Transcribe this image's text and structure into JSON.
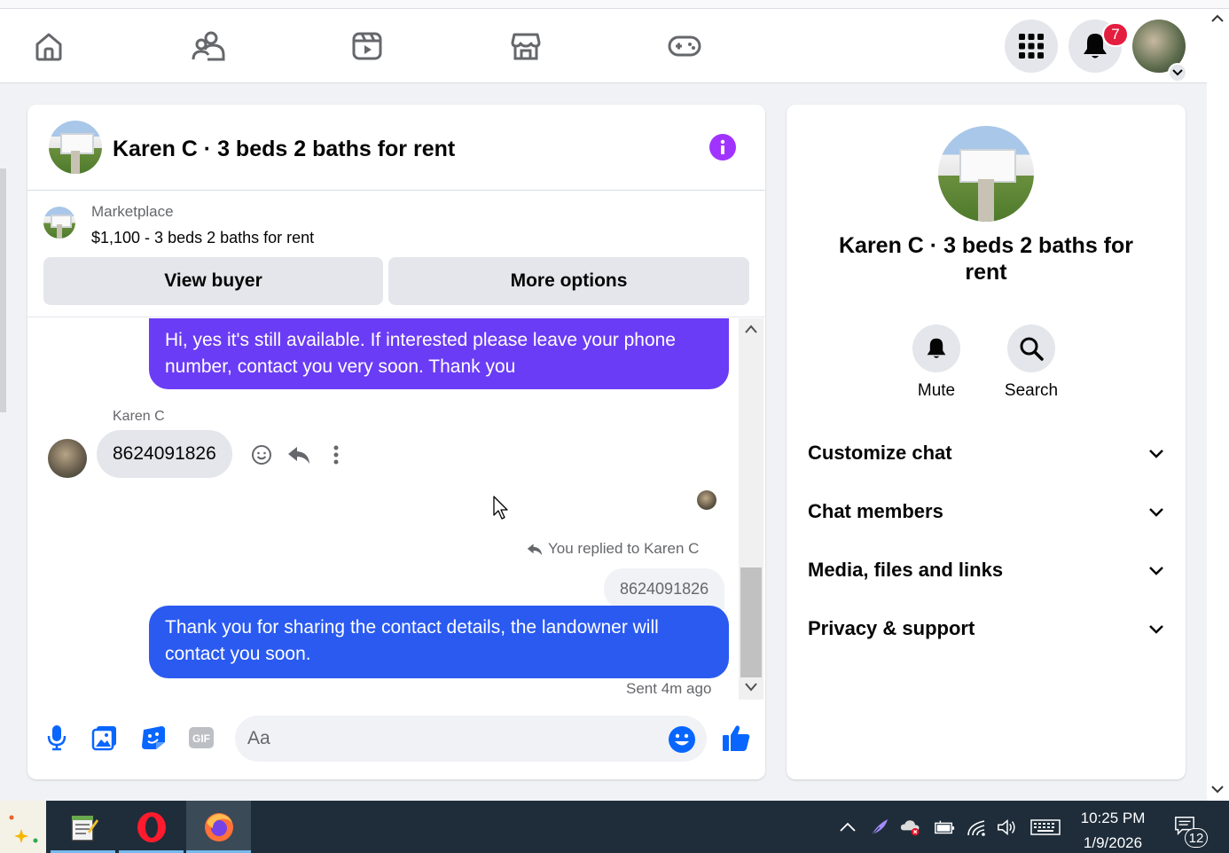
{
  "nav": {
    "icons": [
      "home-icon",
      "friends-icon",
      "video-icon",
      "marketplace-icon",
      "gaming-icon"
    ],
    "menu_icon": "grid-menu-icon",
    "notifications_badge": "7"
  },
  "chat": {
    "title": "Karen C · 3 beds 2 baths for rent",
    "marketplace_label": "Marketplace",
    "listing": "$1,100 - 3 beds 2 baths for rent",
    "view_buyer_label": "View buyer",
    "more_options_label": "More options",
    "messages": {
      "outgoing_1": "Hi, yes it's still available. If interested please leave your phone number, contact you very soon. Thank you",
      "sender_name": "Karen C",
      "incoming_1": "8624091826",
      "replied_label": "You replied to Karen C",
      "quoted_text": "8624091826",
      "outgoing_2": "Thank you for sharing the contact details, the landowner will contact you soon.",
      "sent_status": "Sent 4m ago"
    },
    "composer": {
      "placeholder": "Aa"
    },
    "colors": {
      "bubble_purple": "#6b3cf5",
      "bubble_blue": "#2a5af0",
      "accent": "#0866ff"
    }
  },
  "info_panel": {
    "title": "Karen C · 3 beds 2 baths for rent",
    "mute_label": "Mute",
    "search_label": "Search",
    "sections": [
      "Customize chat",
      "Chat members",
      "Media, files and links",
      "Privacy & support"
    ]
  },
  "taskbar": {
    "time": "10:25 PM",
    "date": "1/9/2026",
    "notification_count": "12"
  }
}
